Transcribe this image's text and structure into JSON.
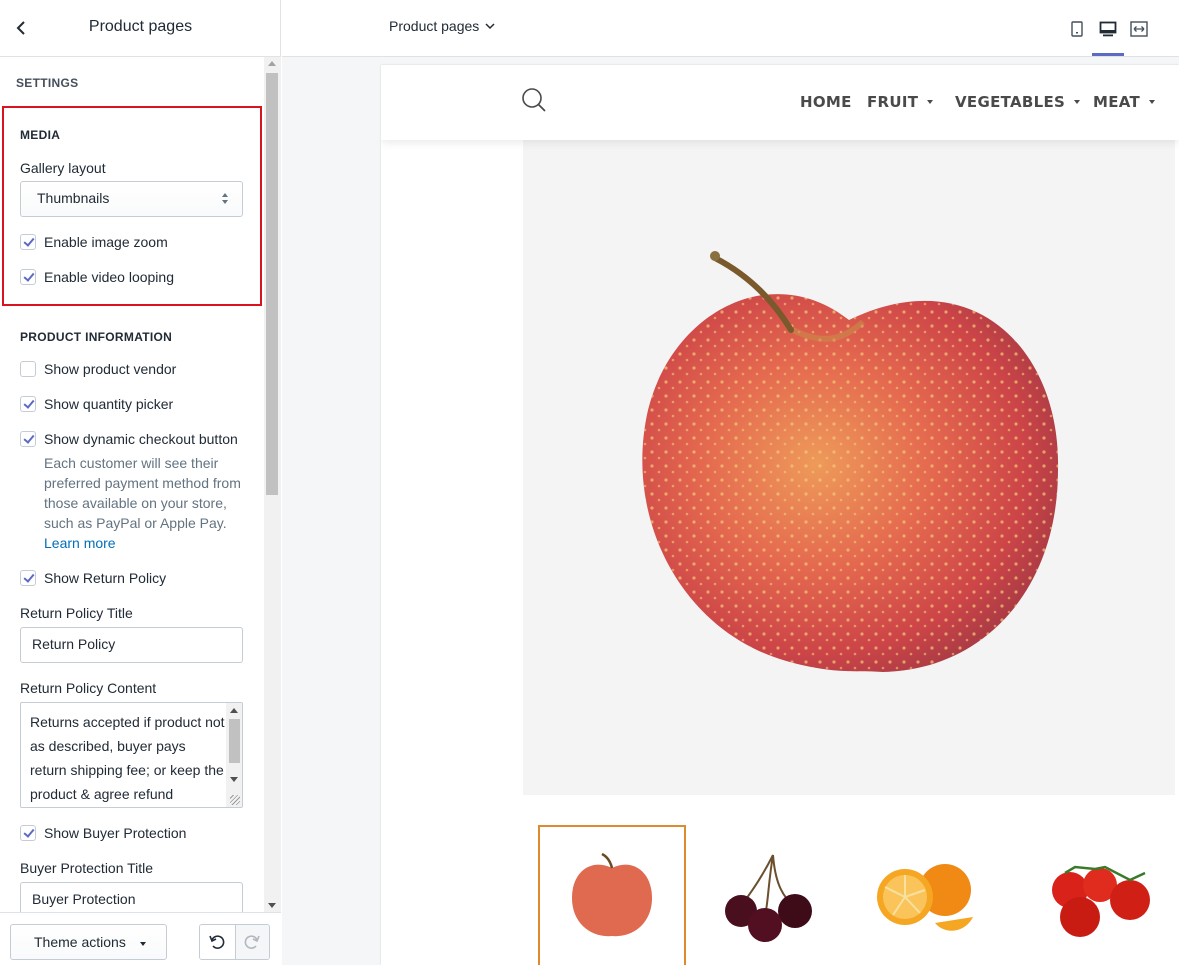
{
  "sidebar": {
    "title": "Product pages",
    "settings_label": "SETTINGS",
    "media": {
      "heading": "MEDIA",
      "gallery_label": "Gallery layout",
      "gallery_value": "Thumbnails",
      "image_zoom": {
        "label": "Enable image zoom",
        "checked": true
      },
      "video_looping": {
        "label": "Enable video looping",
        "checked": true
      }
    },
    "product_info": {
      "heading": "PRODUCT INFORMATION",
      "vendor": {
        "label": "Show product vendor",
        "checked": false
      },
      "quantity": {
        "label": "Show quantity picker",
        "checked": true
      },
      "dynamic_checkout": {
        "label": "Show dynamic checkout button",
        "checked": true
      },
      "dynamic_help": "Each customer will see their preferred payment method from those available on your store, such as PayPal or Apple Pay.",
      "learn_more": "Learn more",
      "return_policy": {
        "label": "Show Return Policy",
        "checked": true
      },
      "return_title_label": "Return Policy Title",
      "return_title_value": "Return Policy",
      "return_content_label": "Return Policy Content",
      "return_content_value": "Returns accepted if product not as described, buyer pays return shipping fee; or keep the product & agree refund",
      "buyer_protection": {
        "label": "Show Buyer Protection",
        "checked": true
      },
      "buyer_title_label": "Buyer Protection Title",
      "buyer_title_value": "Buyer Protection"
    },
    "footer": {
      "theme_actions": "Theme actions"
    }
  },
  "topbar": {
    "page_selector": "Product pages",
    "views": [
      "mobile-view-icon",
      "desktop-view-icon",
      "fullscreen-view-icon"
    ],
    "active_view": "desktop"
  },
  "store": {
    "menu": [
      {
        "label": "HOME",
        "dropdown": false
      },
      {
        "label": "FRUIT",
        "dropdown": true
      },
      {
        "label": "VEGETABLES",
        "dropdown": true
      },
      {
        "label": "MEAT",
        "dropdown": true
      }
    ],
    "main_image": "apple",
    "thumbnails": [
      "apple",
      "cherries",
      "oranges",
      "tomatoes"
    ],
    "active_thumbnail": 0
  },
  "colors": {
    "accent": "#5c6ac4",
    "highlight": "#d9141f",
    "thumb_border": "#e08a2e",
    "link": "#006fbb"
  }
}
